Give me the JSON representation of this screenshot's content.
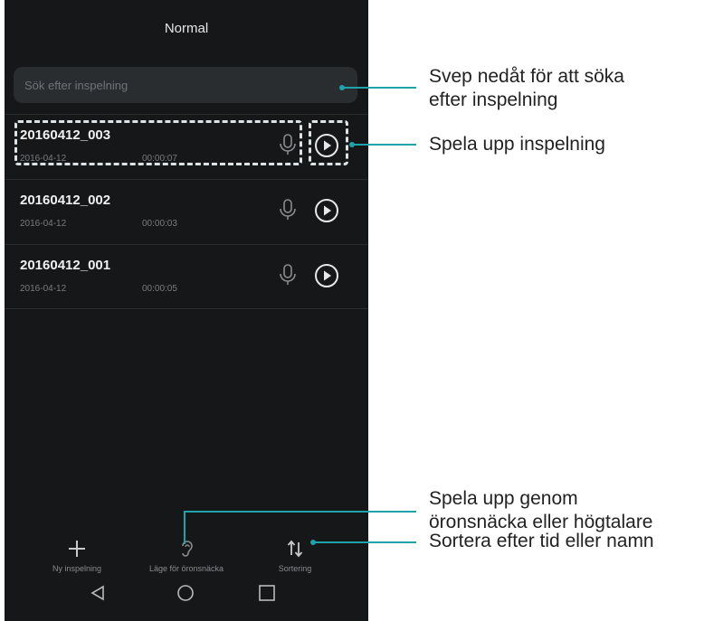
{
  "header": {
    "title": "Normal"
  },
  "search": {
    "placeholder": "Sök efter inspelning"
  },
  "recordings": [
    {
      "name": "20160412_003",
      "date": "2016-04-12",
      "duration": "00:00:07"
    },
    {
      "name": "20160412_002",
      "date": "2016-04-12",
      "duration": "00:00:03"
    },
    {
      "name": "20160412_001",
      "date": "2016-04-12",
      "duration": "00:00:05"
    }
  ],
  "toolbar": {
    "new_recording": "Ny inspelning",
    "earpiece_mode": "Läge för öronsnäcka",
    "sorting": "Sortering"
  },
  "callouts": {
    "search_line1": "Svep nedåt för att söka",
    "search_line2": "efter inspelning",
    "play": "Spela upp inspelning",
    "earpiece_line1": "Spela upp genom",
    "earpiece_line2": "öronsnäcka eller högtalare",
    "sort": "Sortera efter tid eller namn"
  },
  "colors": {
    "accent": "#1ea3a8",
    "background": "#151719",
    "highlight": "#dce3e6"
  },
  "icons": [
    "microphone-icon",
    "play-icon",
    "plus-icon",
    "ear-icon",
    "sort-icon",
    "back-icon",
    "home-icon",
    "recents-icon"
  ]
}
